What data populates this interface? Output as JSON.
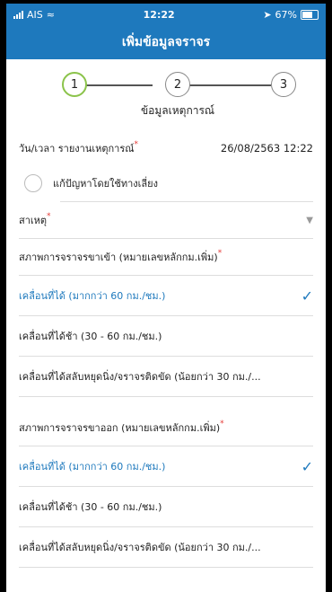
{
  "status_bar": {
    "carrier": "AIS",
    "time": "12:22",
    "battery": "67%"
  },
  "header": {
    "title": "เพิ่มข้อมูลจราจร"
  },
  "stepper": {
    "steps": [
      "1",
      "2",
      "3"
    ],
    "current_label": "ข้อมูลเหตุการณ์"
  },
  "report_time": {
    "label": "วัน/เวลา รายงานเหตุการณ์",
    "value": "26/08/2563 12:22"
  },
  "resolve_option": {
    "label": "แก้ปัญหาโดยใช้ทางเลี่ยง"
  },
  "cause": {
    "label": "สาเหตุ"
  },
  "inbound": {
    "label": "สภาพการจราจรขาเข้า (หมายเลขหลักกม.เพิ่ม)",
    "options": [
      "เคลื่อนที่ได้ (มากกว่า 60 กม./ชม.)",
      "เคลื่อนที่ได้ช้า (30 - 60 กม./ชม.)",
      "เคลื่อนที่ได้สลับหยุดนิ่ง/จราจรติดขัด (น้อยกว่า 30 กม./..."
    ]
  },
  "outbound": {
    "label": "สภาพการจราจรขาออก (หมายเลขหลักกม.เพิ่ม)",
    "options": [
      "เคลื่อนที่ได้ (มากกว่า 60 กม./ชม.)",
      "เคลื่อนที่ได้ช้า (30 - 60 กม./ชม.)",
      "เคลื่อนที่ได้สลับหยุดนิ่ง/จราจรติดขัด (น้อยกว่า 30 กม./..."
    ]
  },
  "selected_index": {
    "inbound": 0,
    "outbound": 0
  },
  "colors": {
    "accent": "#1e79bd",
    "active_step": "#8bc34a",
    "required": "#e53935"
  },
  "icons": {
    "checkmark": "checkmark-icon",
    "dropdown": "caret-down-icon"
  }
}
